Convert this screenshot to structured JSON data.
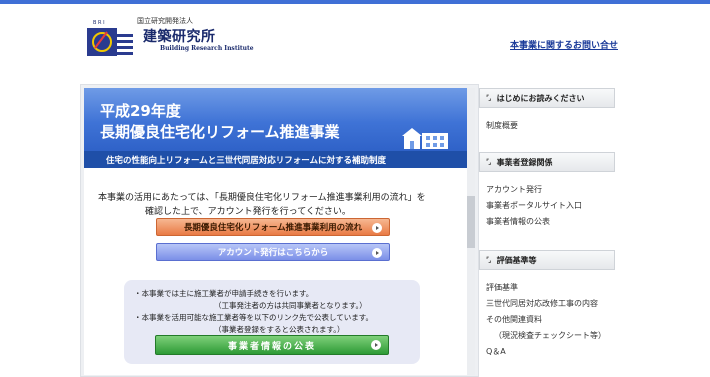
{
  "header": {
    "org_small": "国立研究開発法人",
    "org_name": "建築研究所",
    "org_en": "Building Research Institute",
    "contact_link": "本事業に関するお問い合せ"
  },
  "banner": {
    "title_line1": "平成29年度",
    "title_line2": "長期優良住宅化リフォーム推進事業",
    "subtitle": "住宅の性能向上リフォームと三世代同居対応リフォームに対する補助制度"
  },
  "intro": {
    "line1": "本事業の活用にあたっては、「長期優良住宅化リフォーム推進事業利用の流れ」を",
    "line2": "確認した上で、アカウント発行を行ってください。"
  },
  "buttons": {
    "flow": "長期優良住宅化リフォーム推進事業利用の流れ",
    "account": "アカウント発行はこちらから",
    "public": "事業者情報の公表"
  },
  "notes": {
    "n1": "・本事業では主に施工業者が申請手続きを行います。",
    "n2": "（工事発注者の方は共同事業者となります。）",
    "n3": "・本事業を活用可能な施工業者等を以下のリンク先で公表しています。",
    "n4": "（事業者登録をすると公表されます。）"
  },
  "sidebar": {
    "sections": [
      {
        "title": "はじめにお読みください",
        "items": [
          "制度概要"
        ]
      },
      {
        "title": "事業者登録関係",
        "items": [
          "アカウント発行",
          "事業者ポータルサイト入口",
          "事業者情報の公表"
        ]
      },
      {
        "title": "評価基準等",
        "items": [
          "評価基準",
          "三世代同居対応改修工事の内容",
          "その他関連資料",
          "（現況検査チェックシート等）",
          "Q＆A"
        ]
      }
    ]
  },
  "colors": {
    "accent": "#3f6fd6",
    "banner_dark": "#1f4fa8",
    "button_orange": "#e97a45",
    "button_blue": "#7b8fe8",
    "button_green": "#2e9a36"
  }
}
